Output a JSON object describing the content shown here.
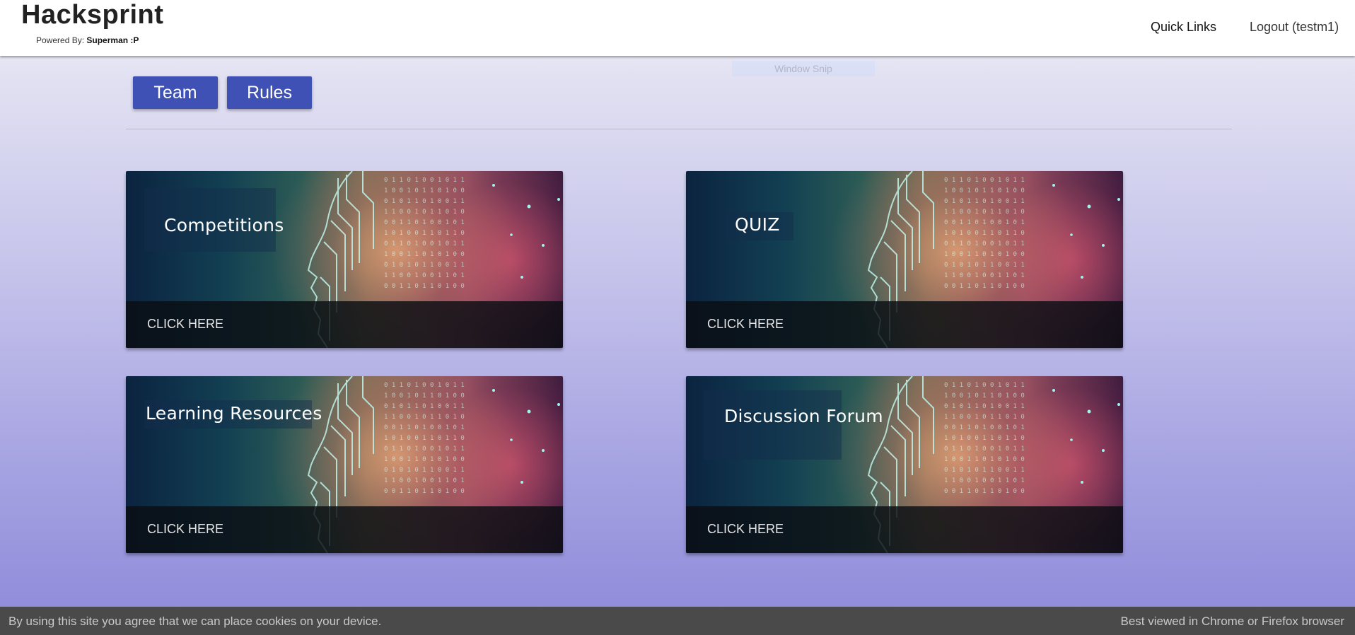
{
  "header": {
    "title": "Hacksprint",
    "powered_by_label": "Powered By:",
    "powered_by_name": "Superman :P",
    "quick_links": "Quick Links",
    "logout": "Logout (testm1)"
  },
  "overlay": {
    "window_snip": "Window Snip"
  },
  "actions": {
    "team": "Team",
    "rules": "Rules"
  },
  "cards": [
    {
      "title": "Competitions",
      "cta": "CLICK HERE"
    },
    {
      "title": "QUIZ",
      "cta": "CLICK HERE"
    },
    {
      "title": "Learning Resources",
      "cta": "CLICK HERE"
    },
    {
      "title": "Discussion Forum",
      "cta": "CLICK HERE"
    }
  ],
  "footer": {
    "cookie_notice": "By using this site you agree that we can place cookies on your device.",
    "browser_note": "Best viewed in Chrome or Firefox browser"
  },
  "colors": {
    "primary_button": "#3f51b5",
    "footer_bg": "#4a4a4a"
  }
}
